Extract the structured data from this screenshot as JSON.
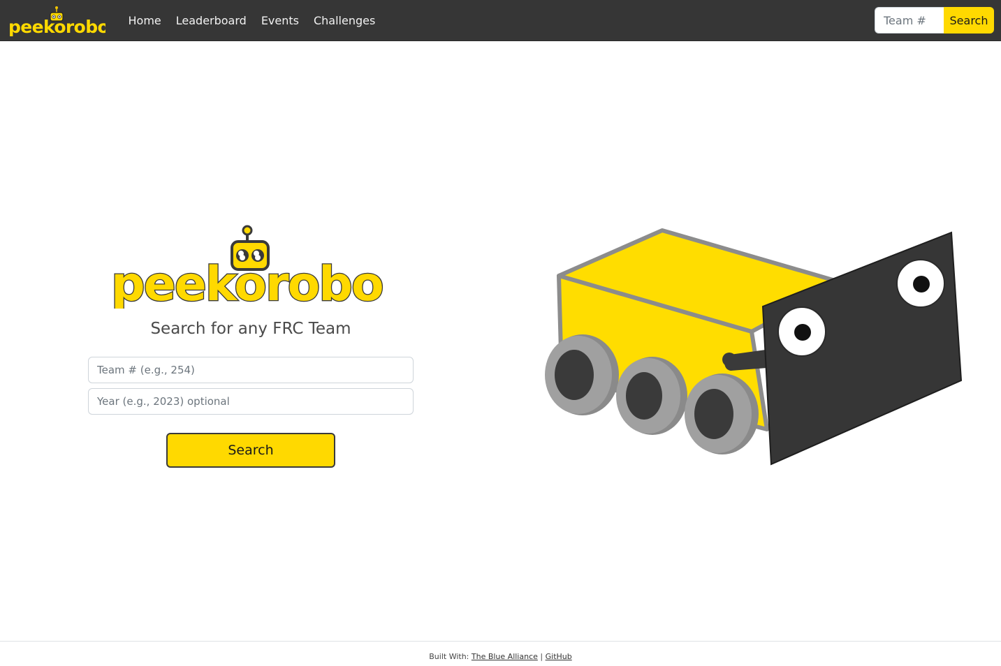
{
  "navbar": {
    "brand": "peekorobo",
    "links": [
      "Home",
      "Leaderboard",
      "Events",
      "Challenges"
    ],
    "search_placeholder": "Team #",
    "search_button": "Search"
  },
  "hero": {
    "logo_text": "peekorobo",
    "tagline": "Search for any FRC Team",
    "team_placeholder": "Team # (e.g., 254)",
    "year_placeholder": "Year (e.g., 2023) optional",
    "search_button": "Search"
  },
  "footer": {
    "prefix": "Built With:",
    "link_tba": "The Blue Alliance",
    "separator": "|",
    "link_github": "GitHub"
  },
  "colors": {
    "brand_yellow": "#ffd900",
    "navbar_bg": "#363636",
    "robot_body": "#ffdd00",
    "robot_panel": "#3a3a3a",
    "wheel": "#8c8c8c"
  },
  "icons": {
    "logo_robot_head": "robot-head-icon",
    "illustration": "robot-illustration"
  }
}
